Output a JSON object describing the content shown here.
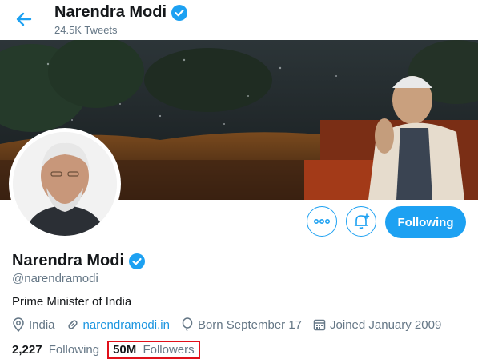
{
  "header": {
    "name": "Narendra Modi",
    "tweet_count": "24.5K Tweets"
  },
  "profile": {
    "name": "Narendra Modi",
    "handle": "@narendramodi",
    "bio": "Prime Minister of India",
    "location": "India",
    "website": "narendramodi.in",
    "born": "Born September 17",
    "joined": "Joined January 2009"
  },
  "buttons": {
    "following_label": "Following"
  },
  "stats": {
    "following_count": "2,227",
    "following_label": "Following",
    "followers_count": "50M",
    "followers_label": "Followers"
  },
  "colors": {
    "accent": "#1da1f2",
    "highlight_box": "#e0101a"
  },
  "icons": [
    "back-arrow-icon",
    "verified-badge-icon",
    "more-icon",
    "notification-bell-icon",
    "location-icon",
    "link-icon",
    "balloon-icon",
    "calendar-icon"
  ]
}
